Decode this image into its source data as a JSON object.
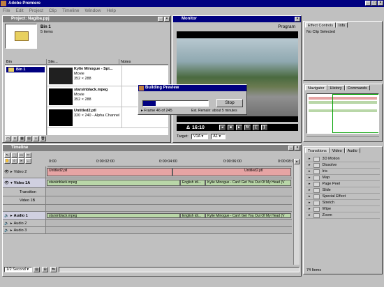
{
  "app": {
    "title": "Adobe Premiere"
  },
  "menu": [
    "File",
    "Edit",
    "Project",
    "Clip",
    "Timeline",
    "Window",
    "Help"
  ],
  "project": {
    "title": "Project: Nagiba.ppj",
    "bin_name": "Bin 1",
    "bin_count": "5 items",
    "col_bin": "Bin",
    "col_bin_item": "Bin 1",
    "col_name": "Name",
    "col_name2": "Sile...",
    "col_notes": "Notes",
    "items": [
      {
        "name": "Kylie Minogue - Spi...",
        "type": "Movie",
        "dims": "352 × 288"
      },
      {
        "name": "starsinblack.mpeg",
        "type": "Movie",
        "dims": "352 × 288"
      },
      {
        "name": "Untitled2.ptl",
        "type": "320 × 240 - Alpha Channel",
        "dims": ""
      }
    ]
  },
  "monitor": {
    "title": "Monitor",
    "program_label": "Program",
    "timecode": "16:10",
    "target_label": "Target:",
    "target_video": "V1A",
    "target_audio": "A1"
  },
  "building_preview": {
    "title": "Building Preview",
    "stop_label": "Stop",
    "frame_text": "Frame 46 of 245",
    "est_text": "Est. Remain: about 5 minutes",
    "progress": 0.19
  },
  "effect_controls": {
    "tab1": "Effect Controls",
    "tab2": "Info",
    "text": "No Clip Selected"
  },
  "navigator": {
    "tab1": "Navigator",
    "tab2": "History",
    "tab3": "Commands"
  },
  "transitions": {
    "tab1": "Transitions",
    "tab2": "Video",
    "tab3": "Audio",
    "items": [
      "3D Motion",
      "Dissolve",
      "Iris",
      "Map",
      "Page Peel",
      "Slide",
      "Special Effect",
      "Stretch",
      "Wipe",
      "Zoom"
    ],
    "count": "74 Items"
  },
  "timeline": {
    "title": "Timeline",
    "ruler": [
      "0:00",
      "0:00:02:00",
      "0:00:04:00",
      "0:00:06:00",
      "0:00:08:00"
    ],
    "zoom": "1/2 Second",
    "tracks": {
      "video2": "Video 2",
      "video1a": "Video 1A",
      "transition": "Transition",
      "video1b": "Video 1B",
      "audio1": "Audio 1",
      "audio2": "Audio 2",
      "audio3": "Audio 3"
    },
    "clips": {
      "untitled_a": "Untitled2.ptl",
      "untitled_b": "Untitled2.ptl",
      "stars_v": "starsinblack.mpeg",
      "english_v": "English idi...",
      "kylie_v": "Kylie Minogue - Can't Get You Out Of My Head (V",
      "stars_a": "starsinblack.mpeg",
      "english_a": "English idi...",
      "kylie_a": "Kylie Minogue - Can't Get You Out Of My Head (V"
    }
  },
  "colors": {
    "title_active": "#000080",
    "title_inactive": "#808080",
    "clip_green": "#b9d7a8",
    "clip_red": "#e6a4a4"
  }
}
